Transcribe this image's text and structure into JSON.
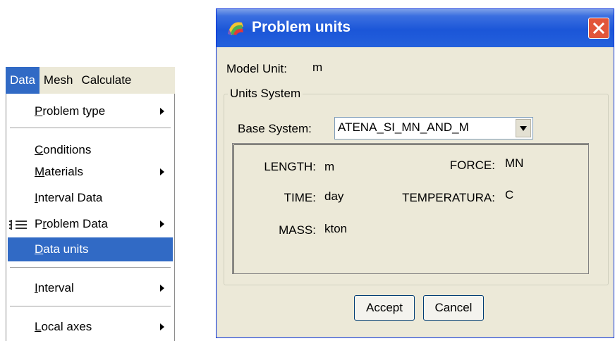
{
  "menubar": {
    "items": [
      "Data",
      "Mesh",
      "Calculate"
    ]
  },
  "menu": {
    "items": [
      {
        "pre": "",
        "u": "P",
        "post": "roblem type",
        "submenu": true
      },
      {
        "pre": "",
        "u": "C",
        "post": "onditions",
        "submenu": false
      },
      {
        "pre": "",
        "u": "M",
        "post": "aterials",
        "submenu": true
      },
      {
        "pre": "",
        "u": "I",
        "post": "nterval Data",
        "submenu": false
      },
      {
        "pre": "P",
        "u": "r",
        "post": "oblem Data",
        "submenu": true
      },
      {
        "pre": "",
        "u": "D",
        "post": "ata units",
        "submenu": false
      },
      {
        "pre": "",
        "u": "I",
        "post": "nterval",
        "submenu": true
      },
      {
        "pre": "",
        "u": "L",
        "post": "ocal axes",
        "submenu": true
      }
    ],
    "selected_index": 5
  },
  "dialog": {
    "title": "Problem units",
    "model_unit_label": "Model Unit:",
    "model_unit_value": "m",
    "group_title": "Units System",
    "base_system_label": "Base System:",
    "base_system_value": "ATENA_SI_MN_AND_M",
    "units": {
      "length_label": "LENGTH:",
      "length_value": "m",
      "force_label": "FORCE:",
      "force_value": "MN",
      "time_label": "TIME:",
      "time_value": "day",
      "temperature_label": "TEMPERATURA:",
      "temperature_value": "C",
      "mass_label": "MASS:",
      "mass_value": "kton"
    },
    "accept_label": "Accept",
    "cancel_label": "Cancel"
  },
  "colors": {
    "selection": "#316ac5",
    "titlebar": "#1b56d8",
    "dialog_bg": "#ece9d8",
    "close": "#e2553a"
  }
}
